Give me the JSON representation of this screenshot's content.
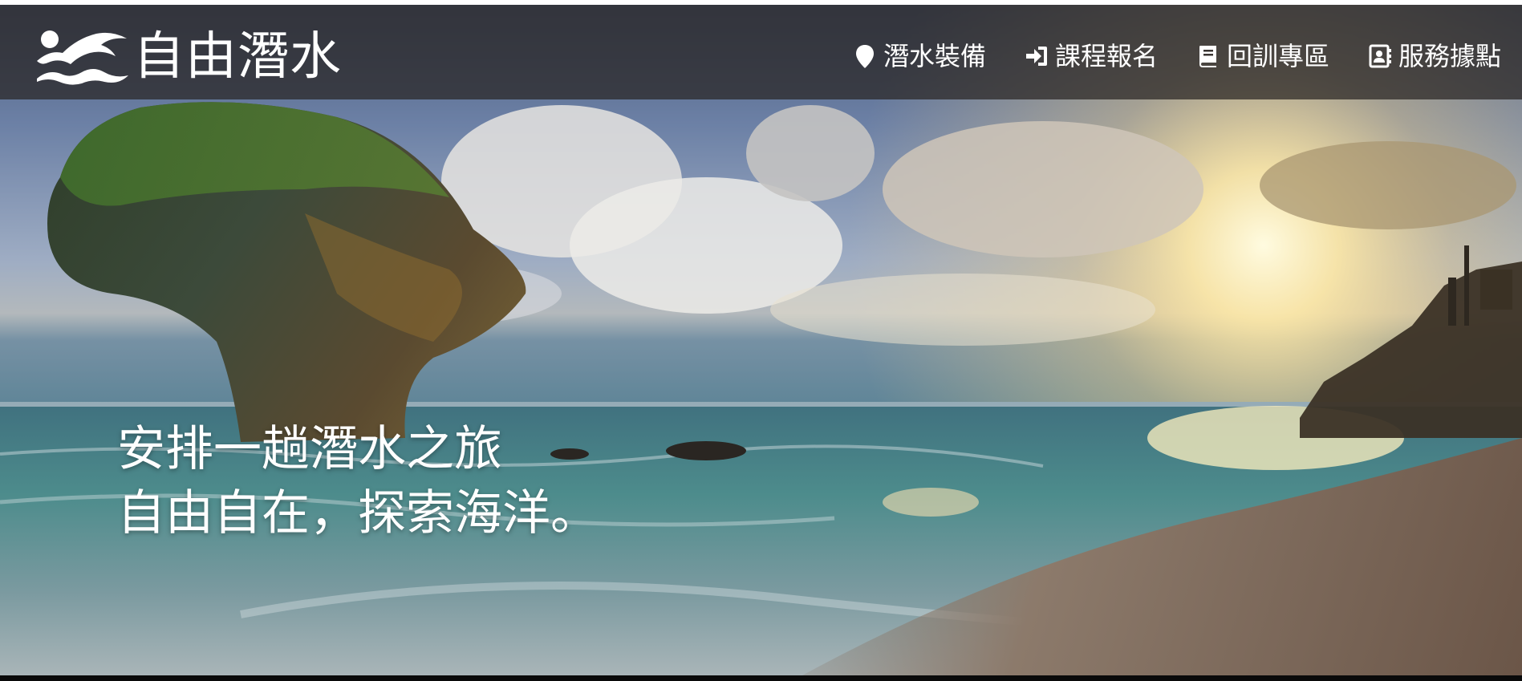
{
  "brand": {
    "name": "自由潛水",
    "logo_icon": "swimmer-wave-logo"
  },
  "nav": {
    "items": [
      {
        "label": "潛水裝備",
        "icon": "map-marker-icon"
      },
      {
        "label": "課程報名",
        "icon": "sign-in-icon"
      },
      {
        "label": "回訓專區",
        "icon": "book-icon"
      },
      {
        "label": "服務據點",
        "icon": "address-card-icon"
      }
    ]
  },
  "hero": {
    "line1": "安排一趟潛水之旅",
    "line2": "自由自在，探索海洋。"
  },
  "colors": {
    "navbar_bg": "#282422",
    "text": "#ffffff",
    "sun": "#fff3c2"
  }
}
